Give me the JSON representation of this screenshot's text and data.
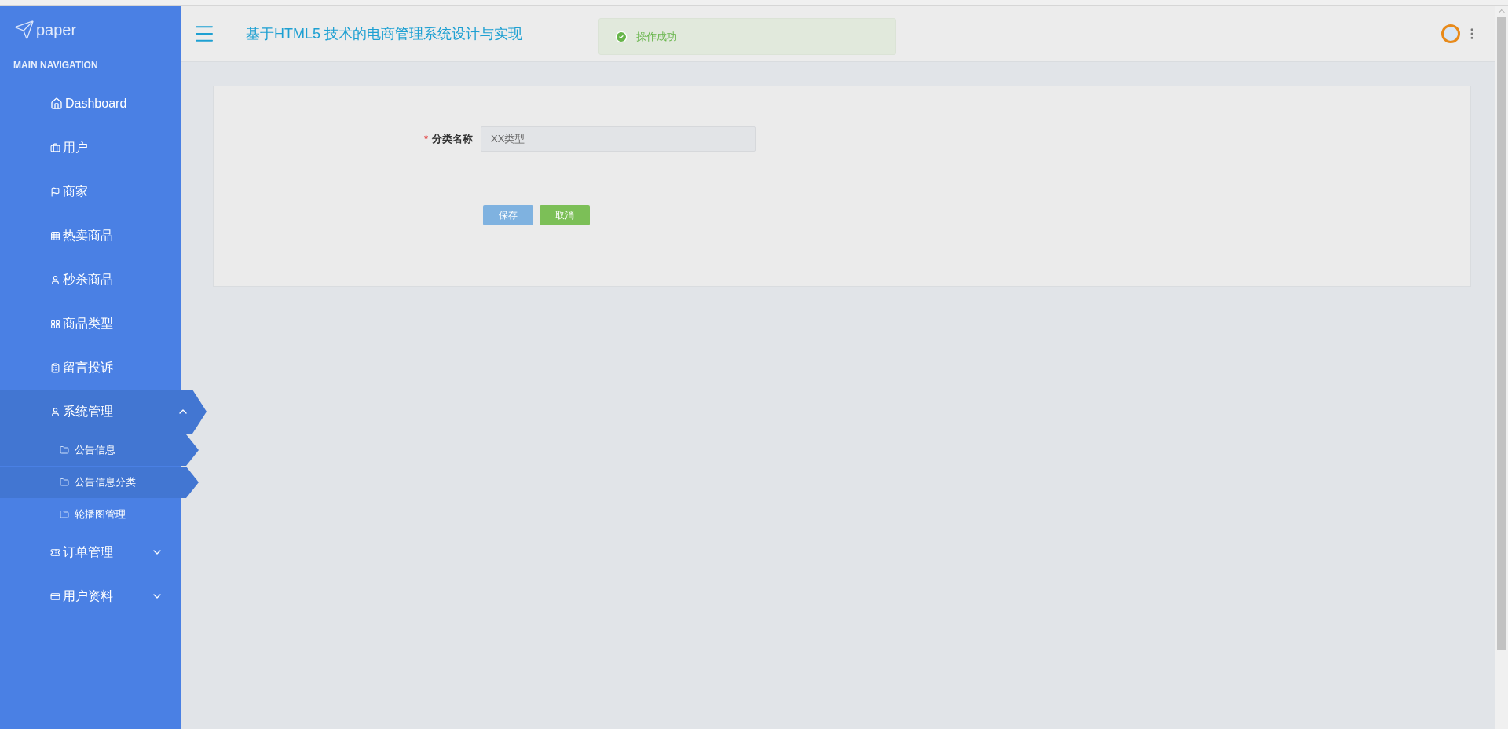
{
  "sidebar": {
    "logo": "paper",
    "section_title": "MAIN NAVIGATION",
    "items": [
      {
        "label": "Dashboard",
        "selected": false
      },
      {
        "label": "用户",
        "selected": false
      },
      {
        "label": "商家",
        "selected": false
      },
      {
        "label": "热卖商品",
        "selected": false
      },
      {
        "label": "秒杀商品",
        "selected": false
      },
      {
        "label": "商品类型",
        "selected": false
      },
      {
        "label": "留言投诉",
        "selected": false
      },
      {
        "label": "系统管理",
        "selected": true,
        "expanded": true,
        "children": [
          {
            "label": "公告信息",
            "selected": true
          },
          {
            "label": "公告信息分类",
            "selected": true
          },
          {
            "label": "轮播图管理",
            "selected": false
          }
        ]
      },
      {
        "label": "订单管理",
        "selected": false,
        "expanded": false
      },
      {
        "label": "用户资料",
        "selected": false,
        "expanded": false
      }
    ]
  },
  "header": {
    "title": "基于HTML5 技术的电商管理系统设计与实现"
  },
  "toast": {
    "message": "操作成功"
  },
  "form": {
    "fields": [
      {
        "label": "分类名称",
        "required_mark": "*",
        "value": "XX类型"
      }
    ],
    "buttons": [
      {
        "label": "保存",
        "kind": "primary"
      },
      {
        "label": "取消",
        "kind": "success"
      }
    ]
  }
}
